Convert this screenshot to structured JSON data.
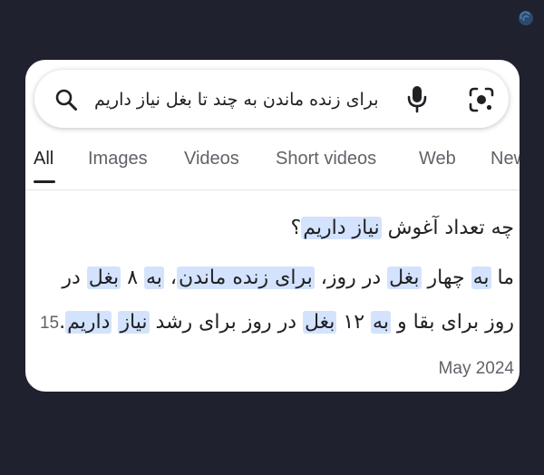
{
  "search": {
    "query": "برای زنده ماندن به چند تا بغل نیاز داریم",
    "icons": {
      "left": "search-icon",
      "right1": "microphone-icon",
      "right2": "camera-lens-icon"
    }
  },
  "tabs": [
    {
      "label": "All",
      "active": true
    },
    {
      "label": "Images"
    },
    {
      "label": "Videos"
    },
    {
      "label": "Short videos"
    },
    {
      "label": "Web"
    },
    {
      "label": "News"
    }
  ],
  "result": {
    "question": {
      "p1": "چه تعداد آغوش ",
      "h1": "نیاز داریم",
      "p2": "؟"
    },
    "answer": {
      "p1": "ما ",
      "h1": "به",
      "p2": " چهار ",
      "h2": "بغل",
      "p3": " در روز، ",
      "h3": "برای زنده ماندن",
      "p4": "، ",
      "h4": "به",
      "p5": " ۸ ",
      "h5": "بغل",
      "p6": " در روز برای بقا و ",
      "h6": "به",
      "p7": " ۱۲ ",
      "h7": "بغل",
      "p8": " در روز برای رشد ",
      "h8": "نیاز",
      "p9": " ",
      "h9": "داریم",
      "p10": "."
    },
    "date": "15 May 2024"
  },
  "colors": {
    "background": "#20212e",
    "highlight": "#d3e3fd",
    "card": "#ffffff"
  }
}
